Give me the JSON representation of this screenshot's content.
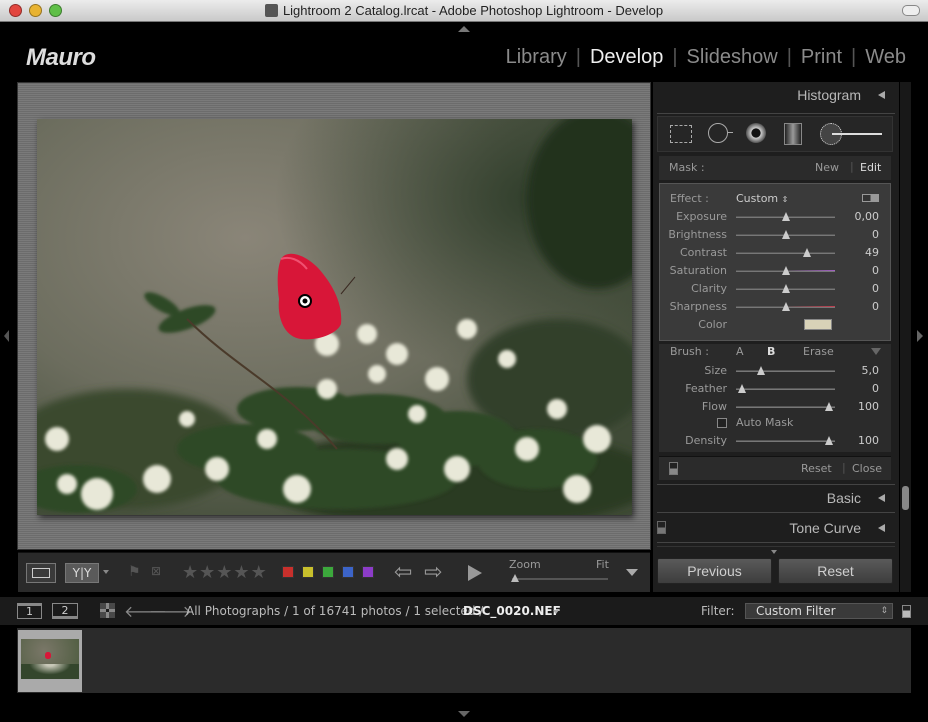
{
  "window": {
    "title": "Lightroom 2 Catalog.lrcat - Adobe Photoshop Lightroom - Develop"
  },
  "identity_plate": "Mauro",
  "modules": [
    "Library",
    "Develop",
    "Slideshow",
    "Print",
    "Web"
  ],
  "active_module": "Develop",
  "right_panel": {
    "histogram_label": "Histogram",
    "mask": {
      "label": "Mask :",
      "new_label": "New",
      "edit_label": "Edit"
    },
    "effect": {
      "label": "Effect :",
      "preset": "Custom"
    },
    "sliders": [
      {
        "label": "Exposure",
        "value": "0,00"
      },
      {
        "label": "Brightness",
        "value": "0"
      },
      {
        "label": "Contrast",
        "value": "49"
      },
      {
        "label": "Saturation",
        "value": "0"
      },
      {
        "label": "Clarity",
        "value": "0"
      },
      {
        "label": "Sharpness",
        "value": "0"
      }
    ],
    "color": {
      "label": "Color",
      "swatch": "#d8d2b8"
    },
    "brush": {
      "label": "Brush :",
      "a_label": "A",
      "b_label": "B",
      "erase_label": "Erase"
    },
    "brush_sliders": [
      {
        "label": "Size",
        "value": "5,0"
      },
      {
        "label": "Feather",
        "value": "0"
      },
      {
        "label": "Flow",
        "value": "100"
      }
    ],
    "auto_mask_label": "Auto Mask",
    "density": {
      "label": "Density",
      "value": "100"
    },
    "reset_label": "Reset",
    "close_label": "Close",
    "basic_label": "Basic",
    "tone_curve_label": "Tone Curve",
    "previous_button": "Previous",
    "reset_button": "Reset"
  },
  "toolbar": {
    "zoom_label": "Zoom",
    "fit_label": "Fit",
    "stars": [
      "★",
      "★",
      "★",
      "★",
      "★"
    ],
    "color_labels": [
      "#c8302c",
      "#c8c02c",
      "#3ca83c",
      "#3c64c8",
      "#8c3cc8"
    ]
  },
  "filmstrip_bar": {
    "monitor1": "1",
    "monitor2": "2",
    "breadcrumb": "All Photographs / 1 of 16741 photos / 1 selected /",
    "filename": "DSC_0020.NEF",
    "filter_label": "Filter:",
    "filter_value": "Custom Filter"
  }
}
